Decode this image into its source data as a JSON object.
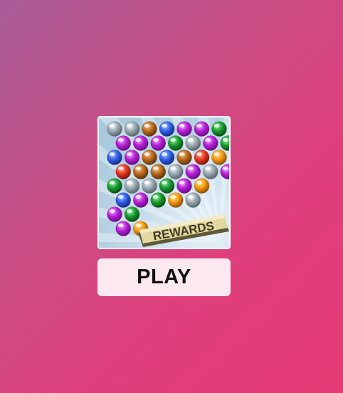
{
  "game": {
    "thumbnail_banner": "REWARDS",
    "play_label": "PLAY"
  },
  "colors": {
    "purple": [
      "#f3a6ff",
      "#b51fd6",
      "#6a0a86"
    ],
    "silver": [
      "#f2f6f8",
      "#9aa8b0",
      "#56636b"
    ],
    "brown": [
      "#f6c58a",
      "#b8681c",
      "#5e3008"
    ],
    "blue": [
      "#a9c6ff",
      "#2f5ee6",
      "#102a86"
    ],
    "green": [
      "#8ff0a0",
      "#1a9a2e",
      "#064d12"
    ],
    "red": [
      "#ffb09a",
      "#e6361e",
      "#7c1208"
    ],
    "orange": [
      "#ffe08a",
      "#f29a10",
      "#8e4a02"
    ]
  },
  "bubbles": [
    [
      "silver",
      "silver",
      "brown",
      "blue",
      "purple",
      "purple",
      "green"
    ],
    [
      "purple",
      "purple",
      "purple",
      "green",
      "silver",
      "purple",
      "green"
    ],
    [
      "blue",
      "purple",
      "brown",
      "blue",
      "brown",
      "red",
      "orange"
    ],
    [
      "red",
      "brown",
      "brown",
      "silver",
      "purple",
      "silver",
      "purple"
    ],
    [
      "green",
      "silver",
      "silver",
      "green",
      "purple",
      "orange"
    ],
    [
      "blue",
      "purple",
      "green",
      "orange",
      "silver"
    ],
    [
      "purple",
      "green"
    ],
    [
      "purple",
      "orange"
    ]
  ]
}
